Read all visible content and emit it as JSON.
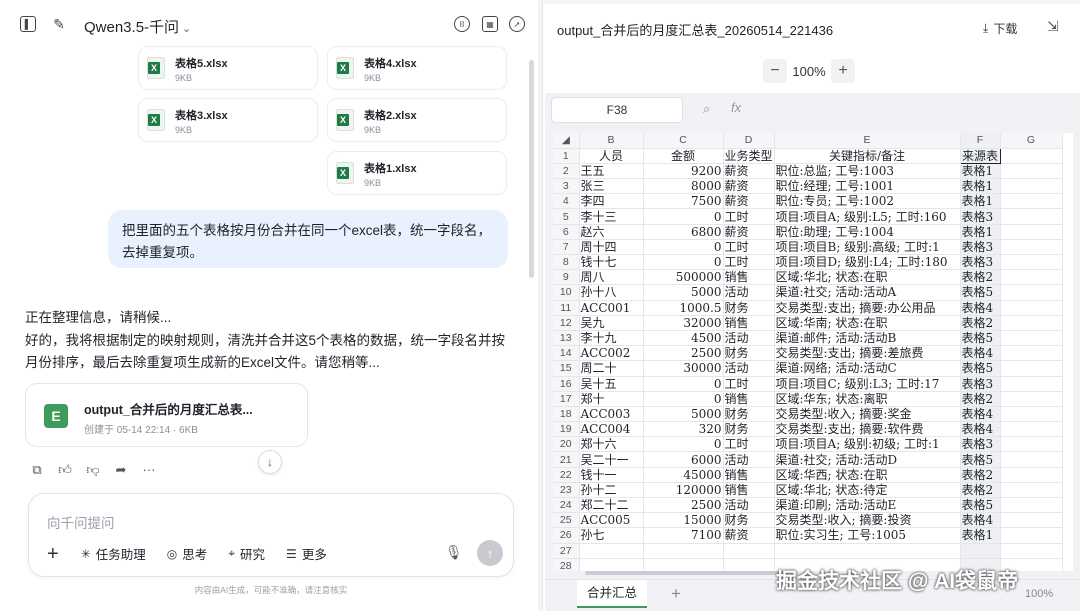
{
  "chat": {
    "model_name": "Qwen3.5-千问",
    "attachments": [
      {
        "name": "表格5.xlsx",
        "size": "9KB"
      },
      {
        "name": "表格4.xlsx",
        "size": "9KB"
      },
      {
        "name": "表格3.xlsx",
        "size": "9KB"
      },
      {
        "name": "表格2.xlsx",
        "size": "9KB"
      },
      {
        "name": "表格1.xlsx",
        "size": "9KB"
      }
    ],
    "user_message": "把里面的五个表格按月份合并在同一个excel表，统一字段名，去掉重复项。",
    "assistant_status": "正在整理信息，请稍候...",
    "assistant_reply_line1": "好的，我将根据制定的映射规则，清洗并合并这5个表格的数据，统一字段名并按",
    "assistant_reply_line2": "月份排序，最后去除重复项生成新的Excel文件。请您稍等...",
    "output_file": {
      "badge": "E",
      "name": "output_合并后的月度汇总表...",
      "meta": "创建于 05-14 22:14 · 6KB"
    },
    "input_placeholder": "向千问提问",
    "tools": [
      {
        "icon": "✳",
        "label": "任务助理"
      },
      {
        "icon": "◎",
        "label": "思考"
      },
      {
        "icon": "⌖",
        "label": "研究"
      },
      {
        "icon": "☰",
        "label": "更多"
      }
    ],
    "disclaimer": "内容由AI生成，可能不准确，请注意核实"
  },
  "sheet": {
    "title": "output_合并后的月度汇总表_20260514_221436",
    "download_label": "下载",
    "zoom": "100%",
    "cell_ref": "F38",
    "fx_label": "fx",
    "col_headers": [
      "B",
      "C",
      "D",
      "E",
      "F",
      "G"
    ],
    "tab_name": "合并汇总",
    "footer_zoom": "100%",
    "rows": [
      [
        "1",
        "人员",
        "金额",
        "业务类型",
        "关键指标/备注",
        "来源表",
        ""
      ],
      [
        "2",
        "王五",
        "9200",
        "薪资",
        "职位:总监; 工号:1003",
        "表格1",
        ""
      ],
      [
        "3",
        "张三",
        "8000",
        "薪资",
        "职位:经理; 工号:1001",
        "表格1",
        ""
      ],
      [
        "4",
        "李四",
        "7500",
        "薪资",
        "职位:专员; 工号:1002",
        "表格1",
        ""
      ],
      [
        "5",
        "李十三",
        "0",
        "工时",
        "项目:项目A; 级别:L5; 工时:160",
        "表格3",
        ""
      ],
      [
        "6",
        "赵六",
        "6800",
        "薪资",
        "职位:助理; 工号:1004",
        "表格1",
        ""
      ],
      [
        "7",
        "周十四",
        "0",
        "工时",
        "项目:项目B; 级别:高级; 工时:1",
        "表格3",
        ""
      ],
      [
        "8",
        "钱十七",
        "0",
        "工时",
        "项目:项目D; 级别:L4; 工时:180",
        "表格3",
        ""
      ],
      [
        "9",
        "周八",
        "500000",
        "销售",
        "区域:华北; 状态:在职",
        "表格2",
        ""
      ],
      [
        "10",
        "孙十八",
        "5000",
        "活动",
        "渠道:社交; 活动:活动A",
        "表格5",
        ""
      ],
      [
        "11",
        "ACC001",
        "1000.5",
        "财务",
        "交易类型:支出; 摘要:办公用品",
        "表格4",
        ""
      ],
      [
        "12",
        "吴九",
        "32000",
        "销售",
        "区域:华南; 状态:在职",
        "表格2",
        ""
      ],
      [
        "13",
        "李十九",
        "4500",
        "活动",
        "渠道:邮件; 活动:活动B",
        "表格5",
        ""
      ],
      [
        "14",
        "ACC002",
        "2500",
        "财务",
        "交易类型:支出; 摘要:差旅费",
        "表格4",
        ""
      ],
      [
        "15",
        "周二十",
        "30000",
        "活动",
        "渠道:网络; 活动:活动C",
        "表格5",
        ""
      ],
      [
        "16",
        "吴十五",
        "0",
        "工时",
        "项目:项目C; 级别:L3; 工时:17",
        "表格3",
        ""
      ],
      [
        "17",
        "郑十",
        "0",
        "销售",
        "区域:华东; 状态:离职",
        "表格2",
        ""
      ],
      [
        "18",
        "ACC003",
        "5000",
        "财务",
        "交易类型:收入; 摘要:奖金",
        "表格4",
        ""
      ],
      [
        "19",
        "ACC004",
        "320",
        "财务",
        "交易类型:支出; 摘要:软件费",
        "表格4",
        ""
      ],
      [
        "20",
        "郑十六",
        "0",
        "工时",
        "项目:项目A; 级别:初级; 工时:1",
        "表格3",
        ""
      ],
      [
        "21",
        "吴二十一",
        "6000",
        "活动",
        "渠道:社交; 活动:活动D",
        "表格5",
        ""
      ],
      [
        "22",
        "钱十一",
        "45000",
        "销售",
        "区域:华西; 状态:在职",
        "表格2",
        ""
      ],
      [
        "23",
        "孙十二",
        "120000",
        "销售",
        "区域:华北; 状态:待定",
        "表格2",
        ""
      ],
      [
        "24",
        "郑二十二",
        "2500",
        "活动",
        "渠道:印刷; 活动:活动E",
        "表格5",
        ""
      ],
      [
        "25",
        "ACC005",
        "15000",
        "财务",
        "交易类型:收入; 摘要:投资",
        "表格4",
        ""
      ],
      [
        "26",
        "孙七",
        "7100",
        "薪资",
        "职位:实习生; 工号:1005",
        "表格1",
        ""
      ],
      [
        "27",
        "",
        "",
        "",
        "",
        "",
        ""
      ],
      [
        "28",
        "",
        "",
        "",
        "",
        "",
        ""
      ]
    ]
  },
  "watermark": "掘金技术社区 @ AI袋鼠帝"
}
